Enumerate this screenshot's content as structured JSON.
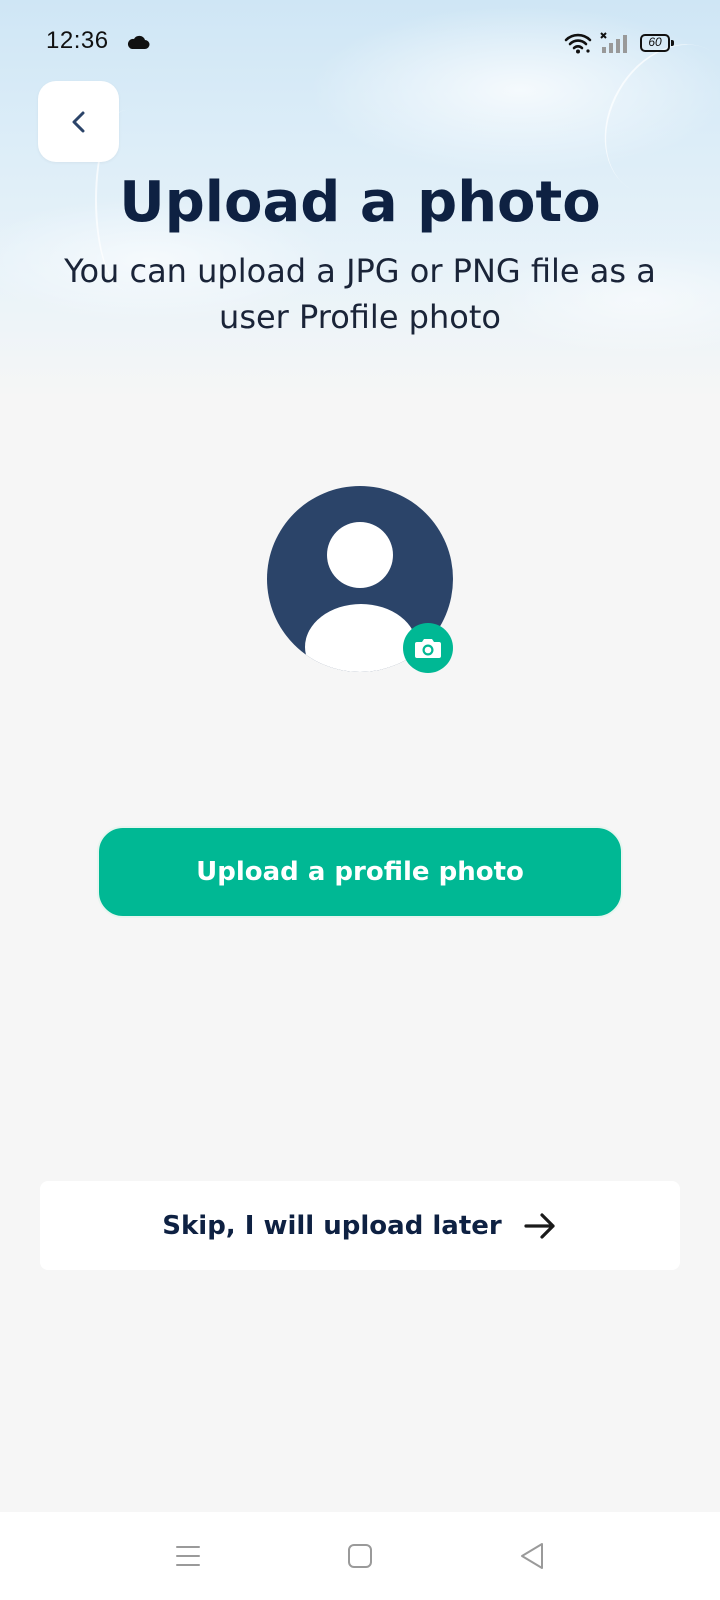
{
  "status_bar": {
    "time": "12:36",
    "battery": "60",
    "icons": [
      "cloud-icon",
      "wifi-icon",
      "signal-icon",
      "battery-icon"
    ]
  },
  "header": {
    "back_icon": "chevron-left-icon",
    "title": "Upload a photo",
    "subtitle": "You can upload a JPG or PNG file as a user Profile photo"
  },
  "avatar": {
    "icon": "user-avatar-icon",
    "badge_icon": "camera-icon"
  },
  "actions": {
    "upload_label": "Upload a profile photo",
    "skip_label": "Skip, I will upload later",
    "skip_icon": "arrow-right-icon"
  },
  "nav_bar": {
    "items": [
      "menu-icon",
      "home-square-icon",
      "back-triangle-icon"
    ]
  },
  "colors": {
    "accent": "#00b894",
    "title": "#0e2142",
    "avatar": "#2b4469",
    "background": "#f6f6f6"
  }
}
